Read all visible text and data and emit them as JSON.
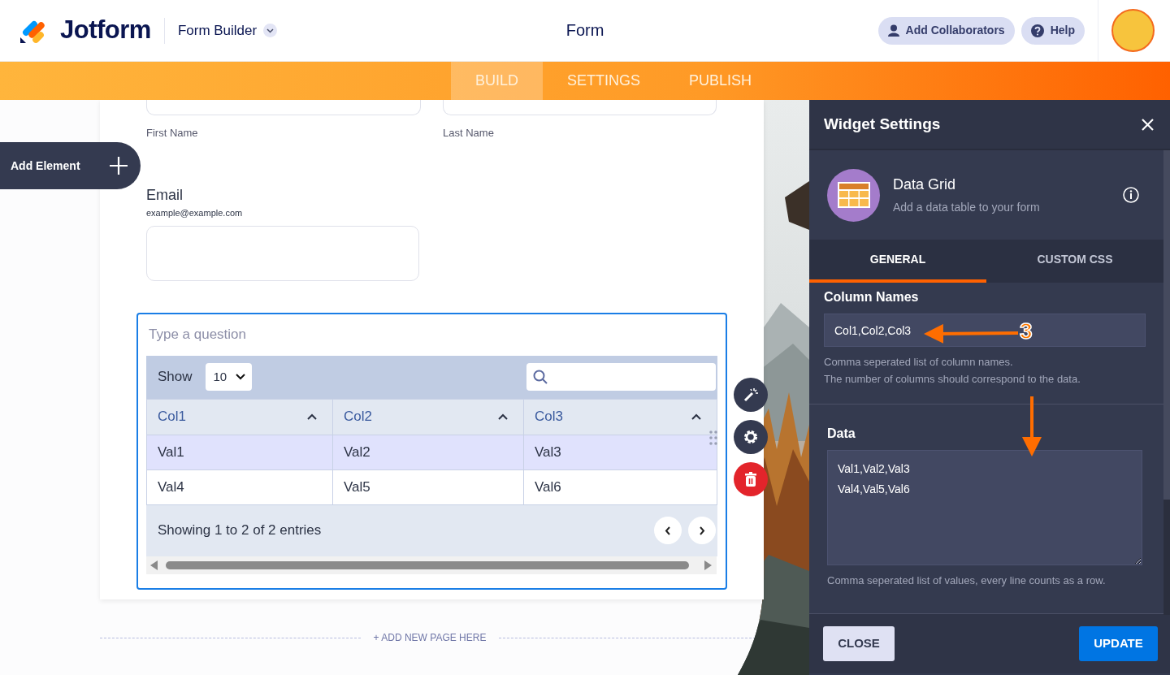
{
  "header": {
    "logo": "Jotform",
    "app_menu": "Form Builder",
    "title": "Form",
    "buttons": [
      {
        "label": "Add Collaborators",
        "kind": "user"
      },
      {
        "label": "Help",
        "kind": "help"
      }
    ]
  },
  "nav_tabs": [
    {
      "label": "BUILD",
      "selected": true
    },
    {
      "label": "SETTINGS",
      "selected": false
    },
    {
      "label": "PUBLISH",
      "selected": false
    }
  ],
  "add_element": {
    "label": "Add Element"
  },
  "form": {
    "name_fields": [
      {
        "label": "First Name"
      },
      {
        "label": "Last Name"
      }
    ],
    "email": {
      "label": "Email",
      "sublabel": "example@example.com"
    },
    "widget": {
      "question_placeholder": "Type a question",
      "show_label": "Show",
      "page_size": "10",
      "columns": [
        "Col1",
        "Col2",
        "Col3"
      ],
      "rows": [
        {
          "cells": [
            "Val1",
            "Val2",
            "Val3"
          ],
          "highlighted": true
        },
        {
          "cells": [
            "Val4",
            "Val5",
            "Val6"
          ],
          "highlighted": false
        }
      ],
      "info": "Showing 1 to 2 of 2 entries"
    }
  },
  "add_page": "+ ADD NEW PAGE HERE",
  "panel": {
    "title": "Widget Settings",
    "widget_name": "Data Grid",
    "widget_description": "Add a data table to your form",
    "tabs": [
      {
        "label": "GENERAL",
        "selected": true
      },
      {
        "label": "CUSTOM CSS",
        "selected": false
      }
    ],
    "fields": [
      {
        "kind": "input",
        "label": "Column Names",
        "value": "Col1,Col2,Col3",
        "help": [
          "Comma seperated list of column names.",
          "The number of columns should correspond to the data."
        ]
      },
      {
        "kind": "textarea",
        "label": "Data",
        "value": "Val1,Val2,Val3\nVal4,Val5,Val6",
        "help": [
          "Comma seperated list of values, every line counts as a row."
        ]
      }
    ],
    "buttons": [
      {
        "label": "CLOSE",
        "kind": "secondary"
      },
      {
        "label": "UPDATE",
        "kind": "primary"
      }
    ]
  },
  "annotation": {
    "label": "3"
  }
}
